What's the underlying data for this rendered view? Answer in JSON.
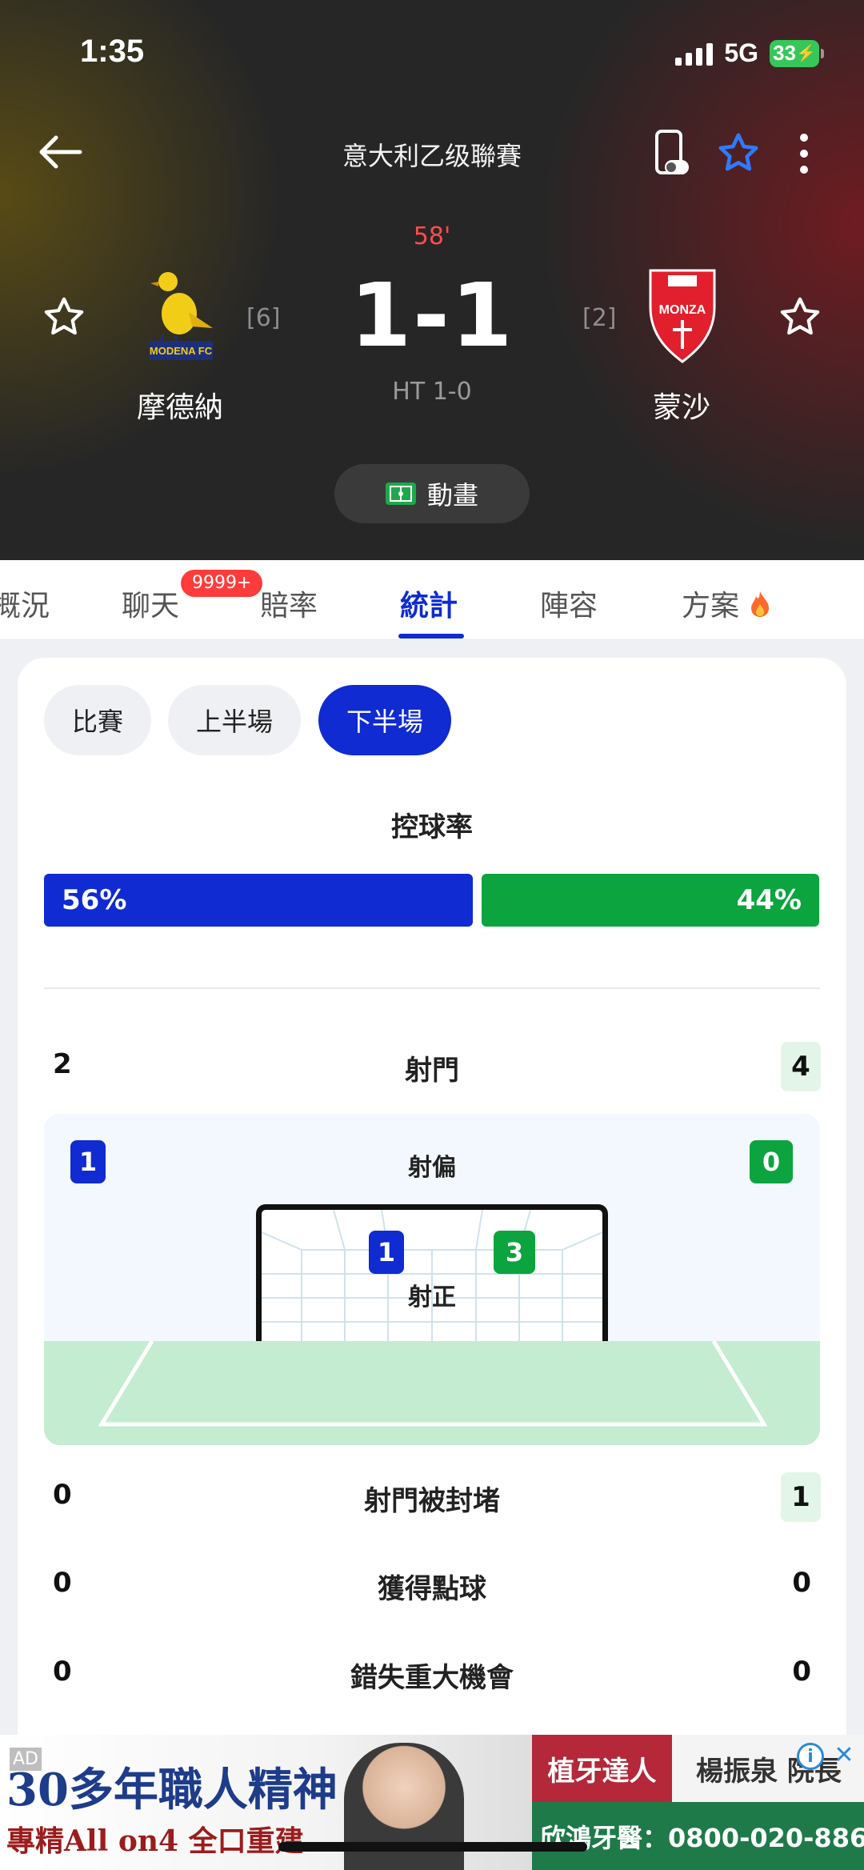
{
  "status": {
    "time": "1:35",
    "network": "5G",
    "battery": "33"
  },
  "header": {
    "league": "意大利乙级聯賽",
    "minute": "58'",
    "score": "1-1",
    "halftime": "HT 1-0",
    "animation_label": "動畫",
    "home": {
      "name": "摩德納",
      "rank": "[6]",
      "logo_text": "MODENA FC"
    },
    "away": {
      "name": "蒙沙",
      "rank": "[2]",
      "logo_text": "MONZA"
    }
  },
  "tabs": {
    "items": [
      "概況",
      "聊天",
      "賠率",
      "統計",
      "陣容",
      "方案"
    ],
    "active": "統計",
    "chat_badge": "9999+"
  },
  "period": {
    "items": [
      "比賽",
      "上半場",
      "下半場"
    ],
    "active": "下半場"
  },
  "stats": {
    "possession": {
      "title": "控球率",
      "home": "56%",
      "away": "44%",
      "home_fraction": 0.56
    },
    "shots": {
      "label": "射門",
      "home": "2",
      "away": "4"
    },
    "off_target": {
      "label": "射偏",
      "home": "1",
      "away": "0"
    },
    "on_target": {
      "label": "射正",
      "home": "1",
      "away": "3"
    },
    "blocked": {
      "label": "射門被封堵",
      "home": "0",
      "away": "1"
    },
    "penalties": {
      "label": "獲得點球",
      "home": "0",
      "away": "0"
    },
    "big_chances_missed": {
      "label": "錯失重大機會",
      "home": "0",
      "away": "0"
    }
  },
  "ad": {
    "tag": "AD",
    "headline": "30多年職人精神",
    "subline": "專精All on4 全口重建",
    "right_top_1": "植牙達人",
    "right_top_2": "楊振泉 院長",
    "right_bottom": "欣鴻牙醫：0800-020-886"
  },
  "colors": {
    "home": "#0f2bd1",
    "away": "#0ba43f",
    "live_minute": "#ff4d4f",
    "chat_badge": "#ff3b3b"
  }
}
